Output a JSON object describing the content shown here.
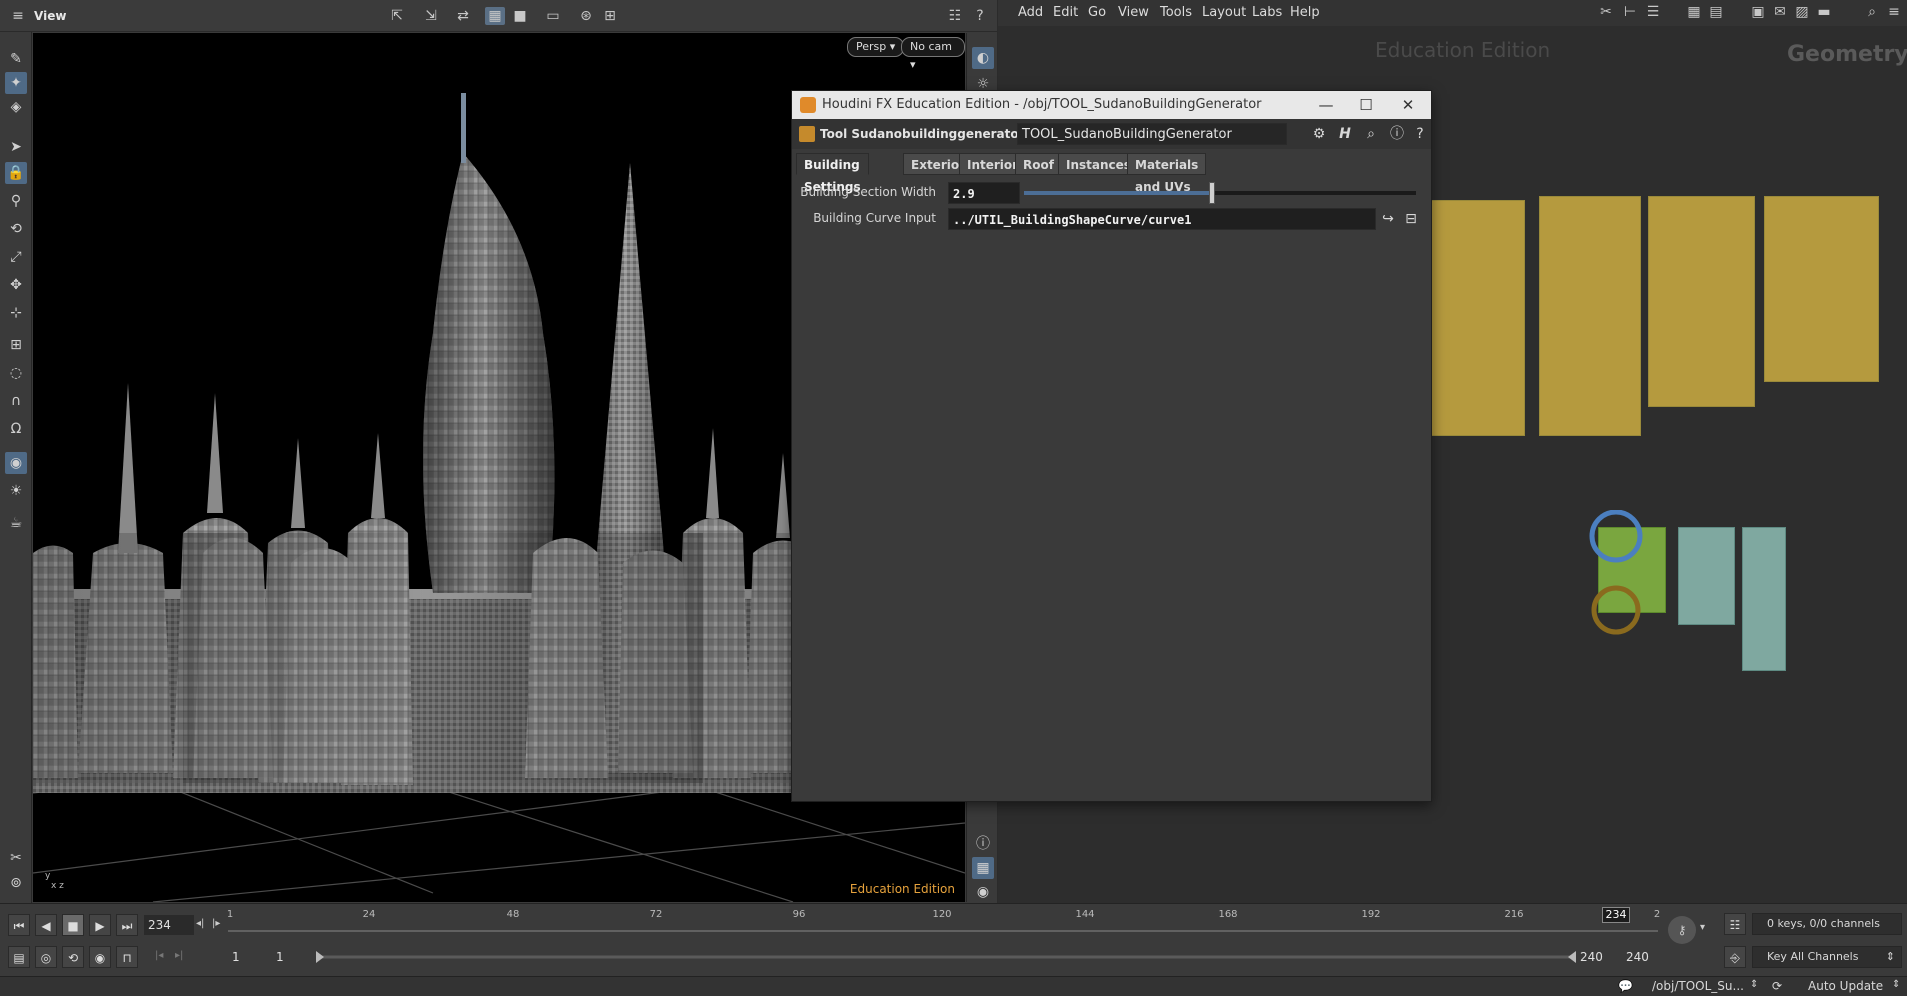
{
  "viewer": {
    "title": "View",
    "persp_label": "Persp",
    "cam_label": "No cam",
    "edu_label": "Education Edition"
  },
  "menubar": {
    "items": [
      "Add",
      "Edit",
      "Go",
      "View",
      "Tools",
      "Layout",
      "Labs",
      "Help"
    ]
  },
  "network": {
    "edu_watermark": "Education Edition",
    "context_label": "Geometry"
  },
  "param_window": {
    "title": "Houdini FX Education Edition - /obj/TOOL_SudanoBuildingGenerator",
    "node_type": "Tool Sudanobuildinggenerator (Dev)",
    "node_name": "TOOL_SudanoBuildingGenerator",
    "tabs": [
      "Building Settings",
      "Exterior",
      "Interior",
      "Roof",
      "Instances",
      "Materials and UVs"
    ],
    "params": {
      "section_width_label": "Building Section Width",
      "section_width_value": "2.9",
      "section_width_slider": 0.48,
      "curve_input_label": "Building Curve Input",
      "curve_input_value": "../UTIL_BuildingShapeCurve/curve1"
    }
  },
  "playbar": {
    "current_frame": "234",
    "ruler_ticks": [
      "1",
      "24",
      "48",
      "72",
      "96",
      "120",
      "144",
      "168",
      "192",
      "216",
      "2"
    ],
    "marker_frame": "234",
    "range_start_a": "1",
    "range_start_b": "1",
    "range_end_a": "240",
    "range_end_b": "240",
    "keys_label": "0 keys, 0/0 channels",
    "key_all_label": "Key All Channels"
  },
  "statusbar": {
    "path": "/obj/TOOL_Su...",
    "update_mode": "Auto Update"
  }
}
